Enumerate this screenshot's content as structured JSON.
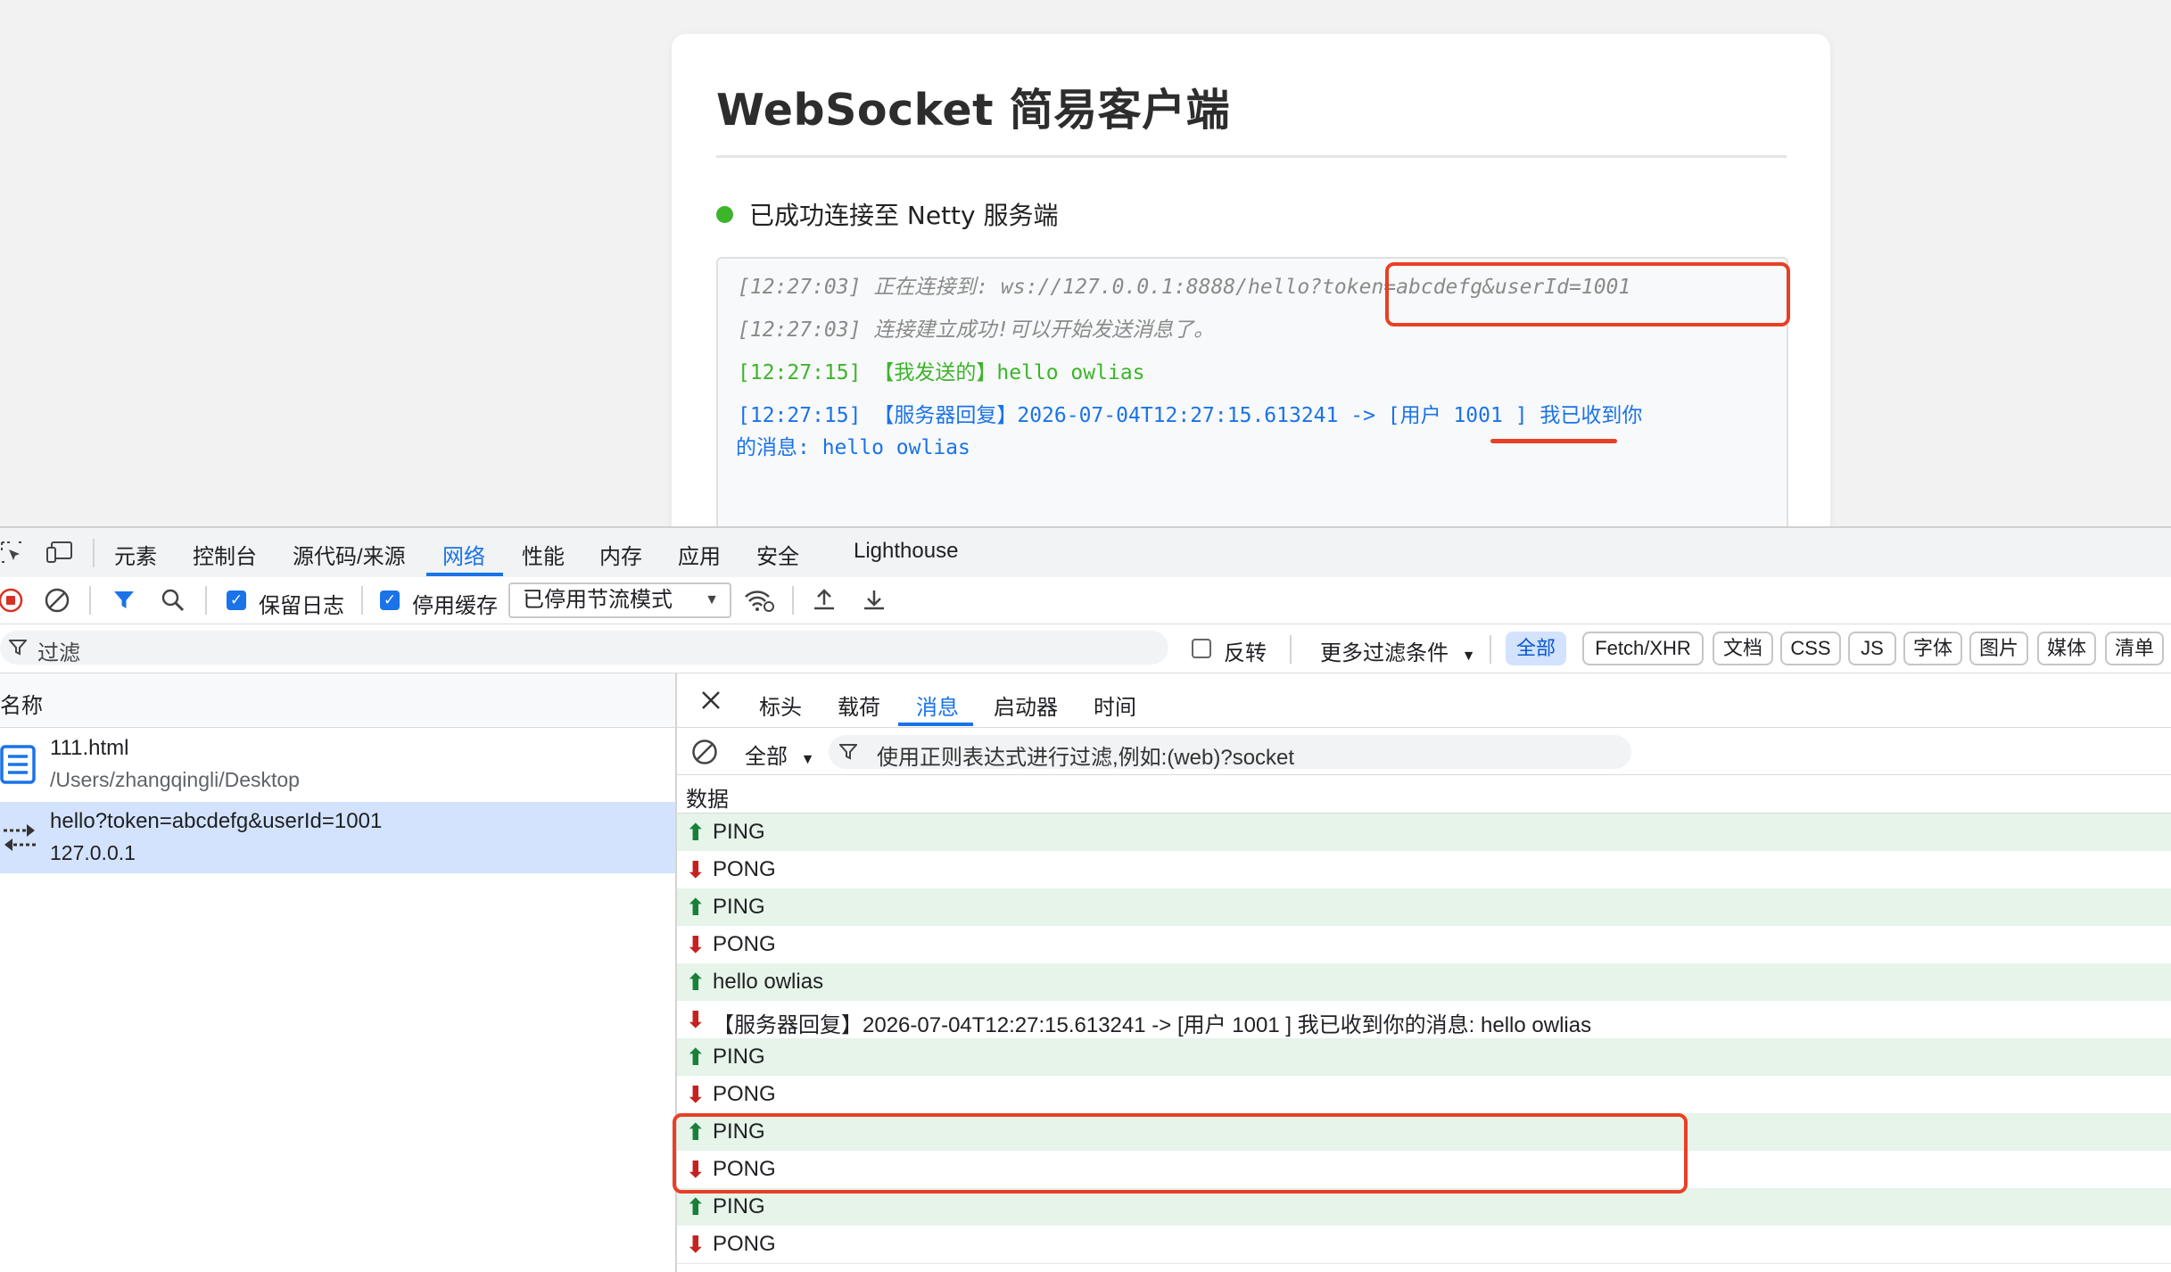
{
  "page": {
    "title": "WebSocket 简易客户端",
    "status_text": "已成功连接至 Netty 服务端",
    "status_color": "#3cb52a",
    "log": [
      {
        "time": "[12:27:03]",
        "text": "正在连接到: ws://127.0.0.1:8888/hello?token=abcdefg&userId=1001",
        "style": "gray"
      },
      {
        "time": "[12:27:03]",
        "text": "连接建立成功!可以开始发送消息了。",
        "style": "gray"
      },
      {
        "time": "[12:27:15]",
        "text": "【我发送的】hello owlias",
        "style": "green"
      },
      {
        "time": "[12:27:15]",
        "text": "【服务器回复】2026-07-04T12:27:15.613241 -> [用户 1001 ] 我已收到你",
        "style": "blue"
      },
      {
        "time": "",
        "text": "的消息: hello owlias",
        "style": "blue"
      }
    ]
  },
  "devtools": {
    "tabs": [
      "元素",
      "控制台",
      "源代码/来源",
      "网络",
      "性能",
      "内存",
      "应用",
      "安全",
      "Lighthouse"
    ],
    "active_tab": "网络",
    "toolbar": {
      "preserve_log": "保留日志",
      "disable_cache": "停用缓存",
      "throttle": "已停用节流模式"
    },
    "filter": {
      "placeholder": "过滤",
      "invert": "反转",
      "more_filters": "更多过滤条件",
      "chips": [
        "全部",
        "Fetch/XHR",
        "文档",
        "CSS",
        "JS",
        "字体",
        "图片",
        "媒体",
        "清单"
      ],
      "active_chip": "全部"
    },
    "requests": {
      "header": "名称",
      "items": [
        {
          "name": "111.html",
          "sub": "/Users/zhangqingli/Desktop"
        },
        {
          "name": "hello?token=abcdefg&userId=1001",
          "sub": "127.0.0.1"
        }
      ]
    },
    "detail": {
      "tabs": [
        "标头",
        "载荷",
        "消息",
        "启动器",
        "时间"
      ],
      "active_tab": "消息",
      "message_filter": {
        "type": "全部",
        "placeholder": "使用正则表达式进行过滤,例如:(web)?socket"
      },
      "data_header": "数据",
      "messages": [
        {
          "dir": "up",
          "text": "PING"
        },
        {
          "dir": "down",
          "text": "PONG"
        },
        {
          "dir": "up",
          "text": "PING"
        },
        {
          "dir": "down",
          "text": "PONG"
        },
        {
          "dir": "up",
          "text": "hello owlias"
        },
        {
          "dir": "down",
          "text": "【服务器回复】2026-07-04T12:27:15.613241 -> [用户 1001 ] 我已收到你的消息: hello owlias"
        },
        {
          "dir": "up",
          "text": "PING"
        },
        {
          "dir": "down",
          "text": "PONG"
        },
        {
          "dir": "up",
          "text": "PING"
        },
        {
          "dir": "down",
          "text": "PONG"
        },
        {
          "dir": "up",
          "text": "PING"
        },
        {
          "dir": "down",
          "text": "PONG"
        }
      ]
    }
  },
  "colors": {
    "accent": "#1a73e8",
    "highlight": "#e84026",
    "up_row": "#e6f4ea",
    "up_arrow": "#188038",
    "down_arrow": "#c5221f"
  }
}
